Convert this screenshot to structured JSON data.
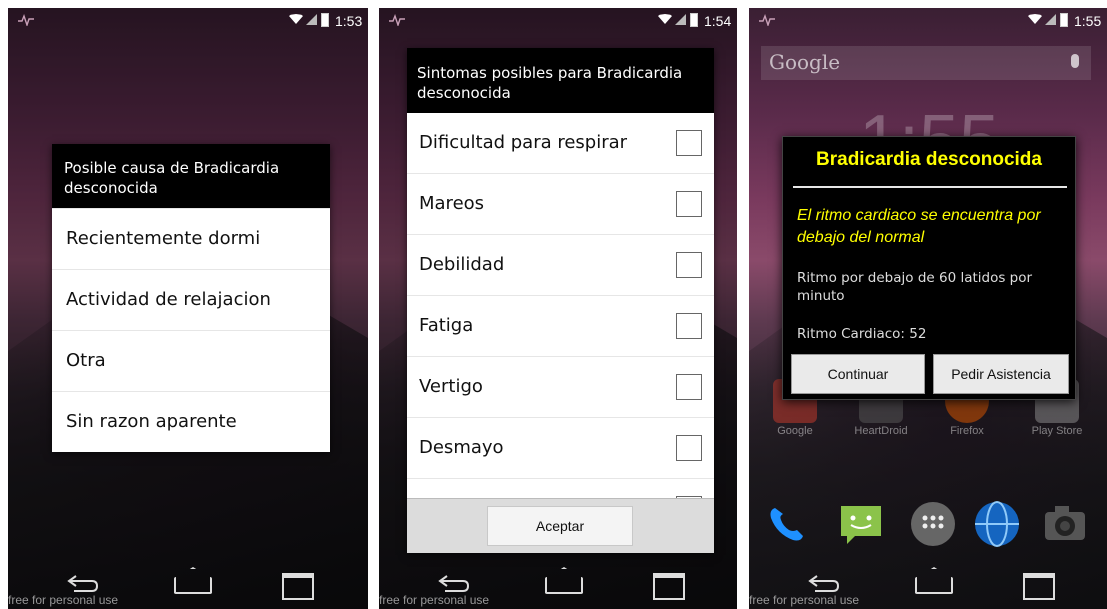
{
  "screens": [
    {
      "status_time": "1:53",
      "watermark": "free for personal use",
      "dialog": {
        "title": "Posible causa de Bradicardia desconocida",
        "options": [
          "Recientemente dormi",
          "Actividad de relajacion",
          "Otra",
          "Sin razon aparente"
        ]
      }
    },
    {
      "status_time": "1:54",
      "watermark": "free for personal use",
      "dialog": {
        "title": "Sintomas posibles para Bradicardia desconocida",
        "symptoms": [
          "Dificultad para respirar",
          "Mareos",
          "Debilidad",
          "Fatiga",
          "Vertigo",
          "Desmayo"
        ],
        "checked": [
          false,
          false,
          false,
          false,
          false,
          false
        ],
        "accept_label": "Aceptar"
      }
    },
    {
      "status_time": "1:55",
      "watermark": "free for personal use",
      "home": {
        "search_logo": "Google",
        "clock": "1:55",
        "apps": [
          "Google",
          "HeartDroid",
          "Firefox",
          "Play Store"
        ]
      },
      "alert": {
        "title": "Bradicardia desconocida",
        "message": "El ritmo cardiaco se encuentra por debajo del normal",
        "description": "Ritmo por debajo de 60 latidos por minuto",
        "heart_rate": "Ritmo Cardiaco: 52",
        "continue_label": "Continuar",
        "assist_label": "Pedir Asistencia"
      }
    }
  ],
  "colors": {
    "alert_title": "#ffff00",
    "dialog_header": "#000000"
  }
}
